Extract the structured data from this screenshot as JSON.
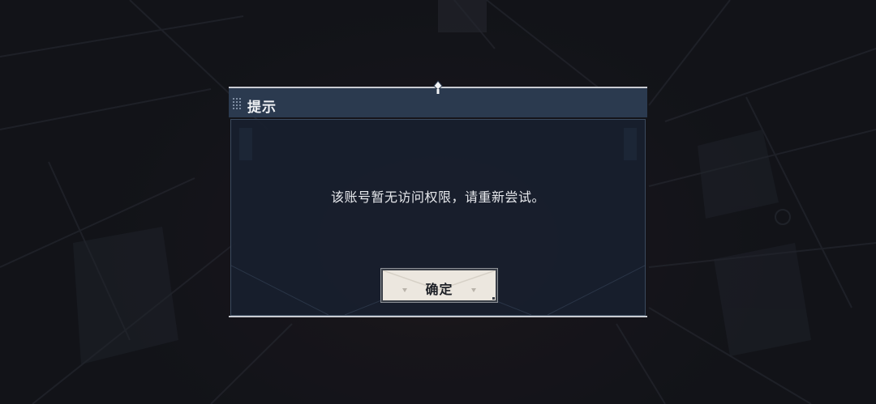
{
  "dialog": {
    "title": "提示",
    "message": "该账号暂无访问权限，请重新尝试。",
    "confirm_label": "确定"
  },
  "colors": {
    "header_bg": "#2b3a4f",
    "body_bg": "#18202e",
    "button_bg": "#ece7df",
    "text_light": "#e6e8ec",
    "text_dark": "#1d2026"
  },
  "icons": {
    "grip": "grip-dots-icon",
    "pin": "pin-icon"
  }
}
